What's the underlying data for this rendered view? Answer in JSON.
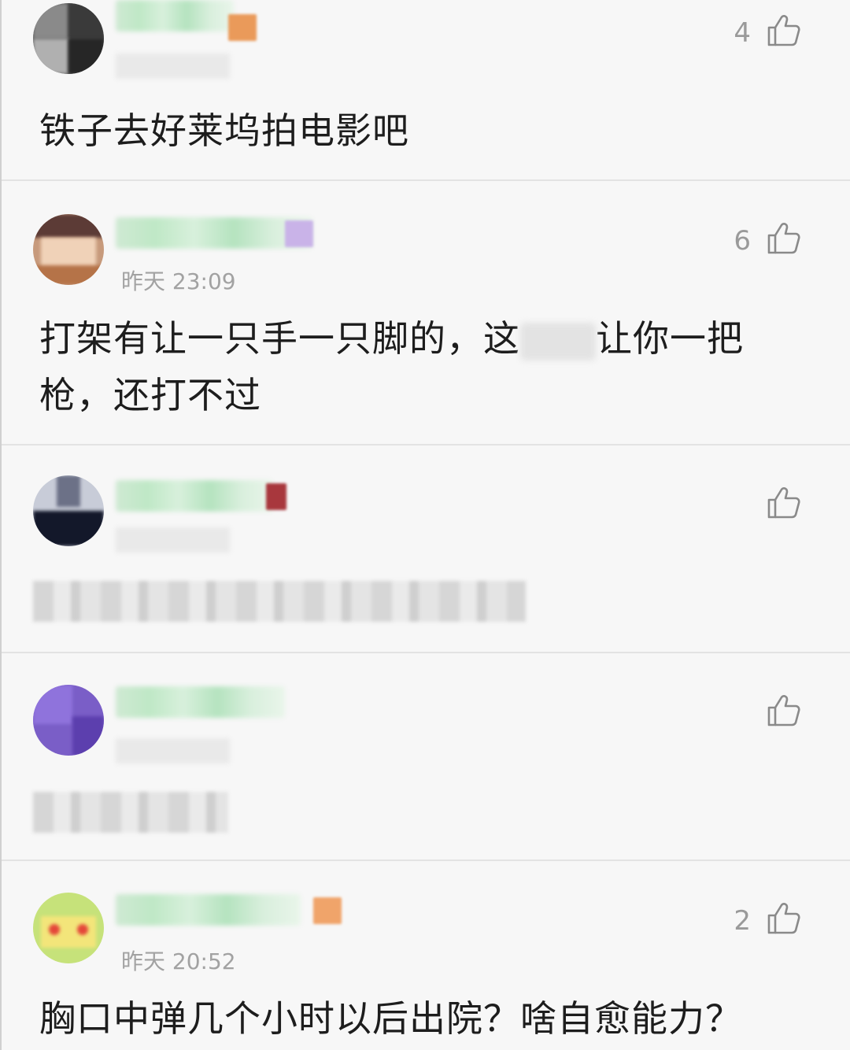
{
  "comments": [
    {
      "time": "",
      "likes": "4",
      "text": "铁子去好莱坞拍电影吧",
      "text_blurred": false
    },
    {
      "time": "昨天 23:09",
      "likes": "6",
      "text_part1": "打架有让一只手一只脚的，这",
      "text_part2": "让你一把枪，还打不过",
      "text_blurred": false
    },
    {
      "time": "",
      "likes": "",
      "text": "",
      "text_blurred": true
    },
    {
      "time": "",
      "likes": "",
      "text": "",
      "text_blurred": true
    },
    {
      "time": "昨天 20:52",
      "likes": "2",
      "text": "胸口中弹几个小时以后出院？啥自愈能力？",
      "text_blurred": false
    }
  ],
  "icons": {
    "like": "thumbs-up-icon"
  },
  "colors": {
    "background": "#f7f7f7",
    "text": "#1d1d1d",
    "meta": "#a2a2a2",
    "divider": "#e3e3e3"
  }
}
